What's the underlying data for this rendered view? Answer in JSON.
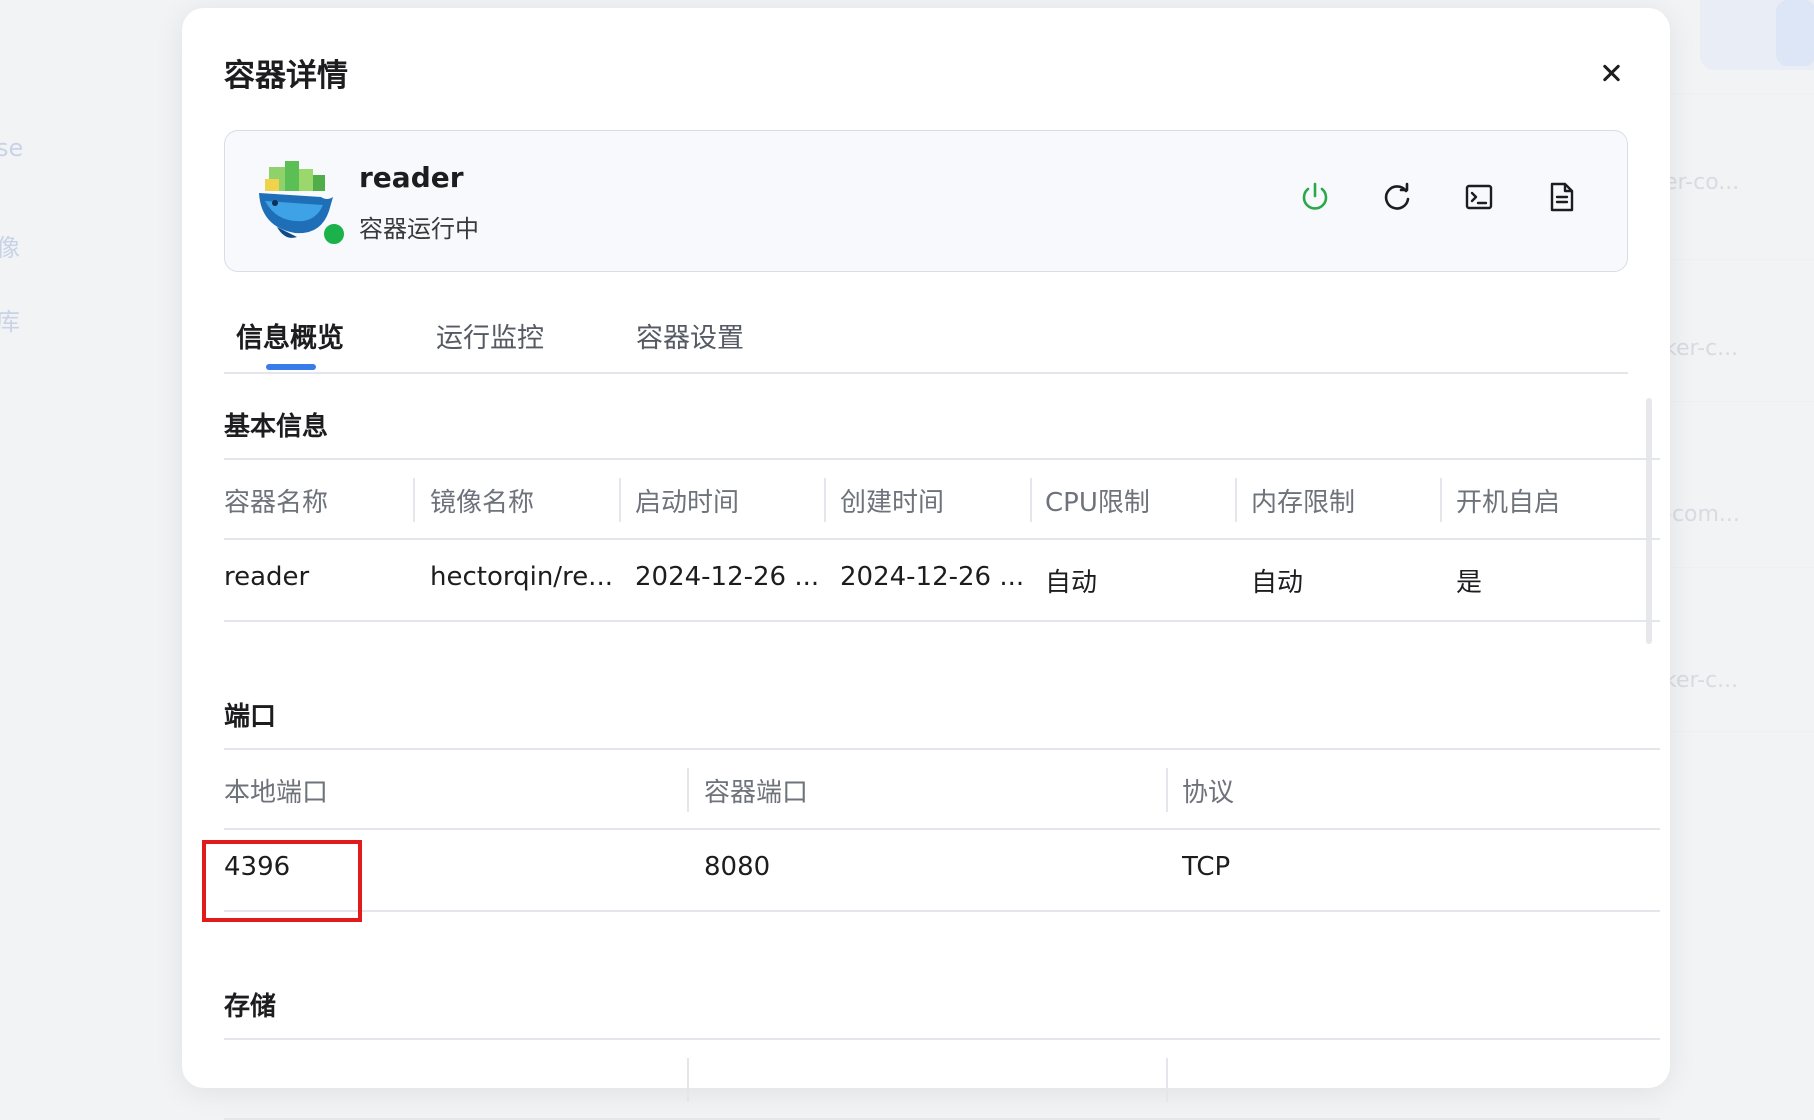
{
  "background": {
    "sidebar_fragments": [
      "se",
      "像",
      "库"
    ],
    "right_fragments": [
      "er-co...",
      "ker-c...",
      "-com...",
      "ker-c..."
    ]
  },
  "modal": {
    "title": "容器详情",
    "close_icon": "close-icon"
  },
  "container": {
    "name": "reader",
    "status": "容器运行中",
    "status_color": "#1bb24b",
    "actions": [
      {
        "name": "power",
        "icon": "power-icon",
        "color": "#2aa84a"
      },
      {
        "name": "restart",
        "icon": "restart-icon",
        "color": "#1d1d1f"
      },
      {
        "name": "terminal",
        "icon": "terminal-icon",
        "color": "#1d1d1f"
      },
      {
        "name": "logs",
        "icon": "document-icon",
        "color": "#1d1d1f"
      }
    ]
  },
  "tabs": [
    {
      "label": "信息概览",
      "active": true
    },
    {
      "label": "运行监控",
      "active": false
    },
    {
      "label": "容器设置",
      "active": false
    }
  ],
  "accent_color": "#3a7bea",
  "basic_info": {
    "title": "基本信息",
    "columns": [
      "容器名称",
      "镜像名称",
      "启动时间",
      "创建时间",
      "CPU限制",
      "内存限制",
      "开机自启"
    ],
    "row": [
      "reader",
      "hectorqin/re...",
      "2024-12-26 ...",
      "2024-12-26 ...",
      "自动",
      "自动",
      "是"
    ]
  },
  "ports": {
    "title": "端口",
    "columns": [
      "本地端口",
      "容器端口",
      "协议"
    ],
    "row": [
      "4396",
      "8080",
      "TCP"
    ]
  },
  "storage": {
    "title": "存储"
  }
}
